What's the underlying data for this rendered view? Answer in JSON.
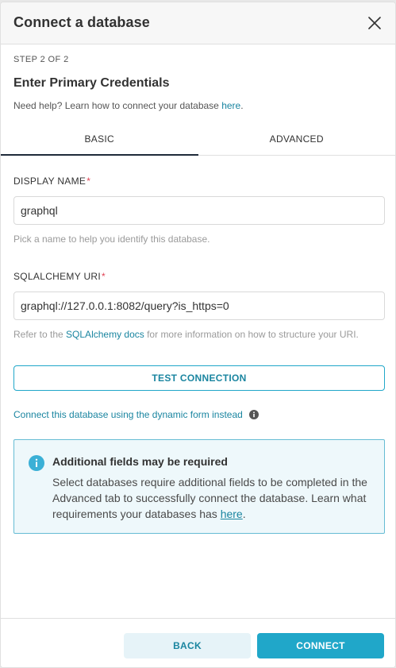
{
  "modal": {
    "title": "Connect a database",
    "close_icon": "close-icon"
  },
  "step": {
    "label": "STEP 2 OF 2",
    "title": "Enter Primary Credentials",
    "help_prefix": "Need help? Learn how to connect your database ",
    "help_link": "here",
    "help_suffix": "."
  },
  "tabs": [
    {
      "label": "BASIC",
      "active": true
    },
    {
      "label": "ADVANCED",
      "active": false
    }
  ],
  "display_name": {
    "label": "DISPLAY NAME",
    "required_mark": "*",
    "value": "graphql",
    "hint": "Pick a name to help you identify this database."
  },
  "sqlalchemy_uri": {
    "label": "SQLALCHEMY URI",
    "required_mark": "*",
    "value": "graphql://127.0.0.1:8082/query?is_https=0",
    "hint_prefix": "Refer to the ",
    "hint_link": "SQLAlchemy docs",
    "hint_suffix": " for more information on how to structure your URI."
  },
  "test_connection": {
    "label": "TEST CONNECTION"
  },
  "dynamic_form": {
    "link": "Connect this database using the dynamic form instead",
    "icon": "info-icon"
  },
  "alert": {
    "icon": "info-icon",
    "title": "Additional fields may be required",
    "body": "Select databases require additional fields to be completed in the Advanced tab to successfully connect the database. Learn what requirements your databases has ",
    "link": "here",
    "suffix": "."
  },
  "footer": {
    "back_label": "BACK",
    "connect_label": "CONNECT"
  },
  "colors": {
    "primary": "#20a7c9",
    "link": "#1a85a0",
    "required": "#e04355",
    "alert_bg": "#eef8fb",
    "alert_border": "#66bcd4",
    "back_bg": "#e6f3f8"
  }
}
